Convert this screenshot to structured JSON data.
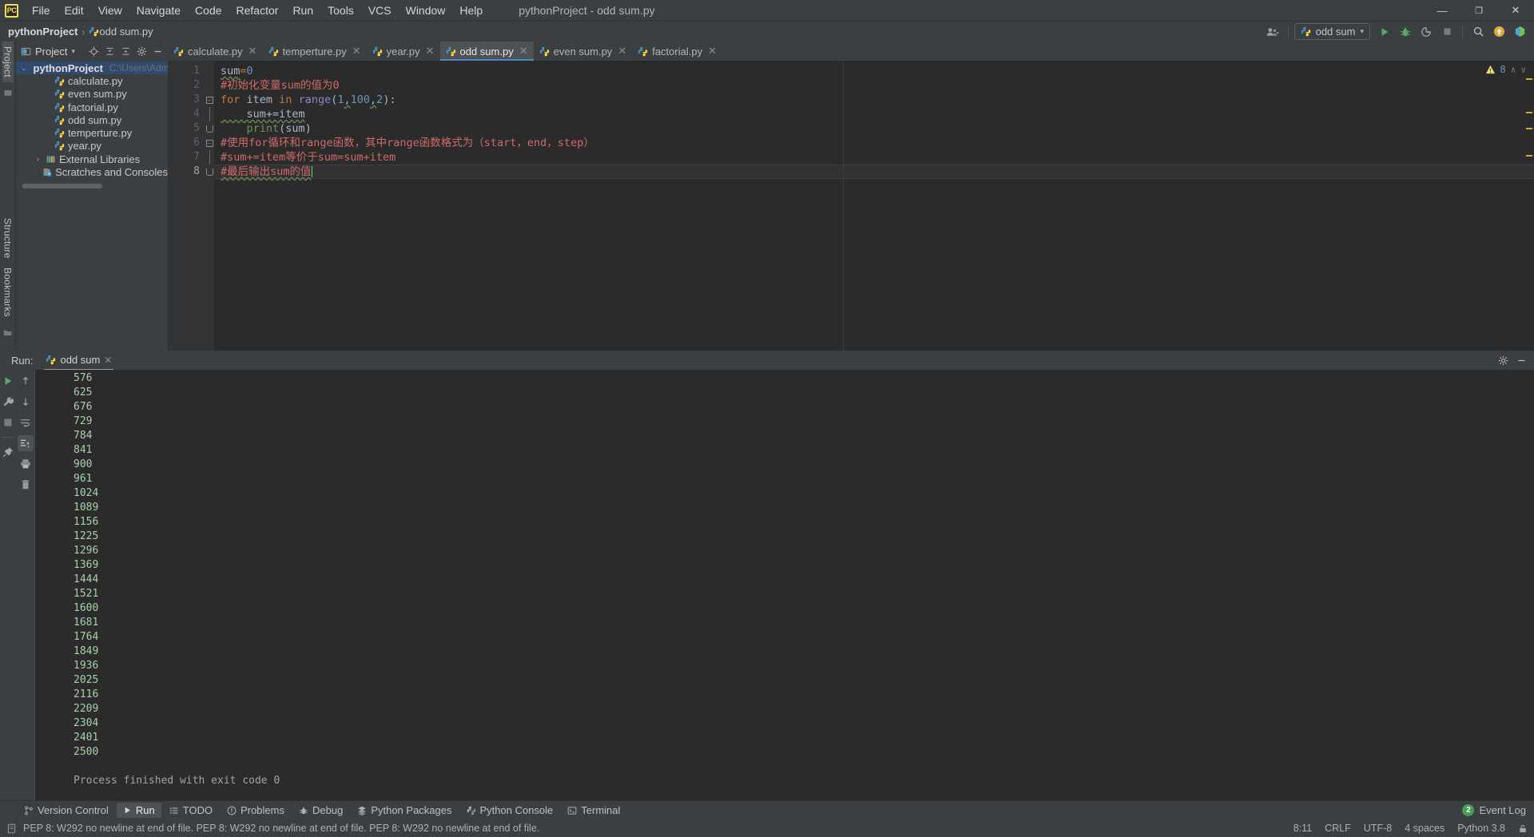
{
  "window": {
    "app_logo": "pycharm-logo",
    "title": "pythonProject - odd sum.py",
    "minimize": "—",
    "maximize": "❐",
    "close": "✕"
  },
  "menu": [
    {
      "label": "File"
    },
    {
      "label": "Edit"
    },
    {
      "label": "View"
    },
    {
      "label": "Navigate"
    },
    {
      "label": "Code"
    },
    {
      "label": "Refactor"
    },
    {
      "label": "Run"
    },
    {
      "label": "Tools"
    },
    {
      "label": "VCS"
    },
    {
      "label": "Window"
    },
    {
      "label": "Help"
    }
  ],
  "breadcrumb": {
    "project": "pythonProject",
    "separator": "›",
    "file": "odd sum.py"
  },
  "toolbar": {
    "run_config": "odd sum",
    "run_icon": "run-icon",
    "debug_icon": "debug-icon",
    "coverage_icon": "coverage-icon",
    "stop_icon": "stop-icon",
    "search_icon": "search-icon",
    "update_icon": "update-project-icon",
    "settings_icon": "settings-icon",
    "user_icon": "user-icon",
    "dropdown_caret": "▾"
  },
  "left_strip": {
    "project_label": "Project",
    "structure_label": "Structure",
    "bookmarks_label": "Bookmarks"
  },
  "project_panel": {
    "title": "Project",
    "title_caret": "▾",
    "icons": [
      "locate-icon",
      "collapse-all-icon",
      "expand-all-icon",
      "settings-icon",
      "hide-icon"
    ],
    "tree": [
      {
        "label": "pythonProject",
        "path": "C:\\Users\\Admini",
        "indent": 0,
        "arrow": "⌄",
        "icon": "folder-icon",
        "bold": true,
        "selected": true
      },
      {
        "label": "calculate.py",
        "path": "",
        "indent": 2,
        "arrow": "",
        "icon": "python-file-icon",
        "bold": false,
        "selected": false
      },
      {
        "label": "even sum.py",
        "path": "",
        "indent": 2,
        "arrow": "",
        "icon": "python-file-icon",
        "bold": false,
        "selected": false
      },
      {
        "label": "factorial.py",
        "path": "",
        "indent": 2,
        "arrow": "",
        "icon": "python-file-icon",
        "bold": false,
        "selected": false
      },
      {
        "label": "odd sum.py",
        "path": "",
        "indent": 2,
        "arrow": "",
        "icon": "python-file-icon",
        "bold": false,
        "selected": false
      },
      {
        "label": "temperture.py",
        "path": "",
        "indent": 2,
        "arrow": "",
        "icon": "python-file-icon",
        "bold": false,
        "selected": false
      },
      {
        "label": "year.py",
        "path": "",
        "indent": 2,
        "arrow": "",
        "icon": "python-file-icon",
        "bold": false,
        "selected": false
      },
      {
        "label": "External Libraries",
        "path": "",
        "indent": 1,
        "arrow": "›",
        "icon": "library-icon",
        "bold": false,
        "selected": false
      },
      {
        "label": "Scratches and Consoles",
        "path": "",
        "indent": 1,
        "arrow": "",
        "icon": "scratches-icon",
        "bold": false,
        "selected": false
      }
    ]
  },
  "editor": {
    "tabs": [
      {
        "label": "calculate.py",
        "active": false
      },
      {
        "label": "temperture.py",
        "active": false
      },
      {
        "label": "year.py",
        "active": false
      },
      {
        "label": "odd sum.py",
        "active": true
      },
      {
        "label": "even sum.py",
        "active": false
      },
      {
        "label": "factorial.py",
        "active": false
      }
    ],
    "tab_close": "✕",
    "warnings": {
      "icon": "warning-icon",
      "count": "8",
      "up": "∧",
      "down": "∨"
    },
    "lines": [
      {
        "number": "1",
        "text": "sum=0"
      },
      {
        "number": "2",
        "text": "#初始化变量sum的值为0"
      },
      {
        "number": "3",
        "text": "for item in range(1,100,2):"
      },
      {
        "number": "4",
        "text": "    sum+=item"
      },
      {
        "number": "5",
        "text": "    print(sum)"
      },
      {
        "number": "6",
        "text": "#使用for循环和range函数，其中range函数格式为（start，end，step）"
      },
      {
        "number": "7",
        "text": "#sum+=item等价于sum=sum+item"
      },
      {
        "number": "8",
        "text": "#最后输出sum的值"
      }
    ],
    "code_tokens": {
      "l1_var": "sum",
      "l1_eq": "=",
      "l1_num": "0",
      "l2_comment": "#初始化变量sum的值为0",
      "l3_for": "for",
      "l3_item": " item ",
      "l3_in": "in",
      "l3_range": " range",
      "l3_open": "(",
      "l3_a": "1",
      "l3_c1": ",",
      "l3_b": "100",
      "l3_c2": ",",
      "l3_d": "2",
      "l3_close": "):",
      "l4_text": "    sum+=item",
      "l5_print": "print",
      "l5_open": "(",
      "l5_sum": "sum",
      "l5_close": ")",
      "l6_comment": "#使用for循环和range函数，其中range函数格式为（start，end，step）",
      "l7_comment": "#sum+=item等价于sum=sum+item",
      "l8_comment": "#最后输出sum的值"
    }
  },
  "run_panel": {
    "label": "Run:",
    "tab": "odd sum",
    "tab_close": "✕",
    "settings_icon": "gear-icon",
    "hide_icon": "hide-icon",
    "toolbar_icons": [
      "rerun-icon",
      "settings-wrench-icon",
      "stop-icon",
      "scroll-up-icon",
      "scroll-down-icon",
      "soft-wrap-icon",
      "scroll-to-end-icon",
      "print-icon",
      "clear-all-icon",
      "pin-icon"
    ],
    "output": [
      "576",
      "625",
      "676",
      "729",
      "784",
      "841",
      "900",
      "961",
      "1024",
      "1089",
      "1156",
      "1225",
      "1296",
      "1369",
      "1444",
      "1521",
      "1600",
      "1681",
      "1764",
      "1849",
      "1936",
      "2025",
      "2116",
      "2209",
      "2304",
      "2401",
      "2500"
    ],
    "finish_message": "Process finished with exit code 0"
  },
  "tool_window_bar": {
    "items": [
      {
        "label": "Version Control",
        "icon": "branch-icon",
        "selected": false
      },
      {
        "label": "Run",
        "icon": "run-icon",
        "selected": true
      },
      {
        "label": "TODO",
        "icon": "todo-icon",
        "selected": false
      },
      {
        "label": "Problems",
        "icon": "problems-icon",
        "selected": false
      },
      {
        "label": "Debug",
        "icon": "debug-icon",
        "selected": false
      },
      {
        "label": "Python Packages",
        "icon": "packages-icon",
        "selected": false
      },
      {
        "label": "Python Console",
        "icon": "python-console-icon",
        "selected": false
      },
      {
        "label": "Terminal",
        "icon": "terminal-icon",
        "selected": false
      }
    ],
    "event_log": {
      "count": "2",
      "label": "Event Log"
    }
  },
  "status_bar": {
    "icon": "inspection-icon",
    "message": "PEP 8: W292 no newline at end of file. PEP 8: W292 no newline at end of file. PEP 8: W292 no newline at end of file.",
    "caret_position": "8:11",
    "line_separator": "CRLF",
    "encoding": "UTF-8",
    "indent": "4 spaces",
    "interpreter": "Python 3.8",
    "lock_icon": "lock-icon"
  },
  "colors": {
    "background": "#3c3f41",
    "editor_bg": "#2b2b2b",
    "accent": "#4a88c7",
    "comment": "#cf6a6a",
    "keyword": "#cc7832",
    "number": "#6897bb",
    "output": "#a9d2a9",
    "selection": "#2f4a6d"
  }
}
